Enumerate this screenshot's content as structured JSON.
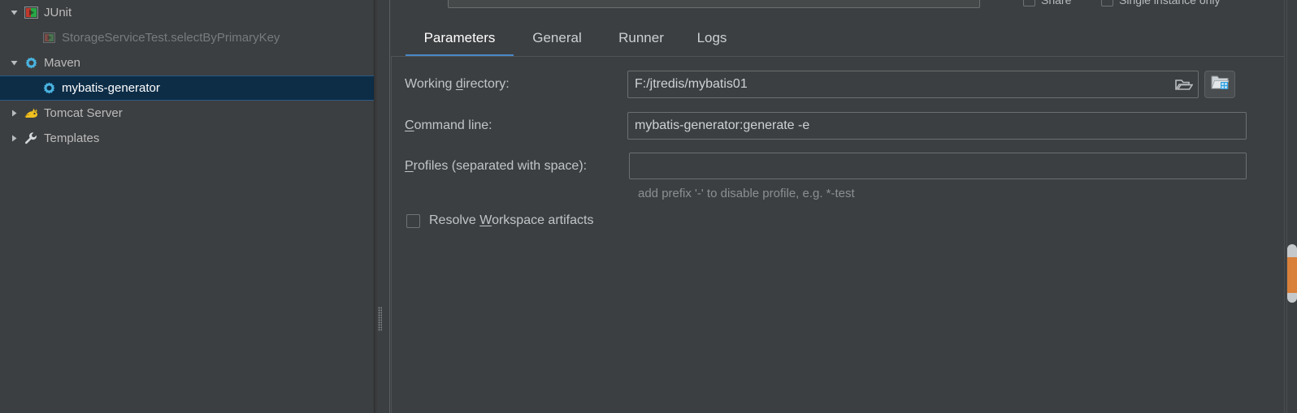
{
  "sidebar": {
    "items": [
      {
        "label": "JUnit",
        "icon": "junit-icon",
        "twisty": "expanded",
        "indent": 1,
        "selected": false,
        "dim": false
      },
      {
        "label": "StorageServiceTest.selectByPrimaryKey",
        "icon": "junit-test-icon",
        "twisty": "none",
        "indent": 2,
        "selected": false,
        "dim": true
      },
      {
        "label": "Maven",
        "icon": "maven-gear-icon",
        "twisty": "expanded",
        "indent": 1,
        "selected": false,
        "dim": false
      },
      {
        "label": "mybatis-generator",
        "icon": "maven-gear-icon",
        "twisty": "none",
        "indent": 2,
        "selected": true,
        "dim": false
      },
      {
        "label": "Tomcat Server",
        "icon": "tomcat-cat-icon",
        "twisty": "collapsed",
        "indent": 1,
        "selected": false,
        "dim": false
      },
      {
        "label": "Templates",
        "icon": "wrench-icon",
        "twisty": "collapsed",
        "indent": 1,
        "selected": false,
        "dim": false
      }
    ]
  },
  "top_strip": {
    "name_field_value": "",
    "share_label": "Share",
    "single_instance_label": "Single instance only"
  },
  "tabs": [
    {
      "label": "Parameters",
      "active": true
    },
    {
      "label": "General",
      "active": false
    },
    {
      "label": "Runner",
      "active": false
    },
    {
      "label": "Logs",
      "active": false
    }
  ],
  "form": {
    "working_directory": {
      "label_pre": "Working ",
      "label_mnemonic": "d",
      "label_post": "irectory:",
      "value": "F:/jtredis/mybatis01",
      "inline_browse_icon": "folder-open-icon",
      "module_button_icon": "module-folder-icon"
    },
    "command_line": {
      "label_pre": "",
      "label_mnemonic": "C",
      "label_post": "ommand line:",
      "value": "mybatis-generator:generate -e"
    },
    "profiles": {
      "label_pre": "",
      "label_mnemonic": "P",
      "label_post": "rofiles (separated with space):",
      "value": "",
      "hint": "add prefix '-' to disable profile, e.g. *-test"
    },
    "resolve_workspace": {
      "label_pre": "Resolve ",
      "label_mnemonic": "W",
      "label_post": "orkspace artifacts",
      "checked": false
    }
  },
  "colors": {
    "panel_bg": "#3c3f41",
    "selection_bg": "#0d2d47",
    "accent_blue": "#4a88c7",
    "scroll_marker_orange": "#d9803a"
  }
}
